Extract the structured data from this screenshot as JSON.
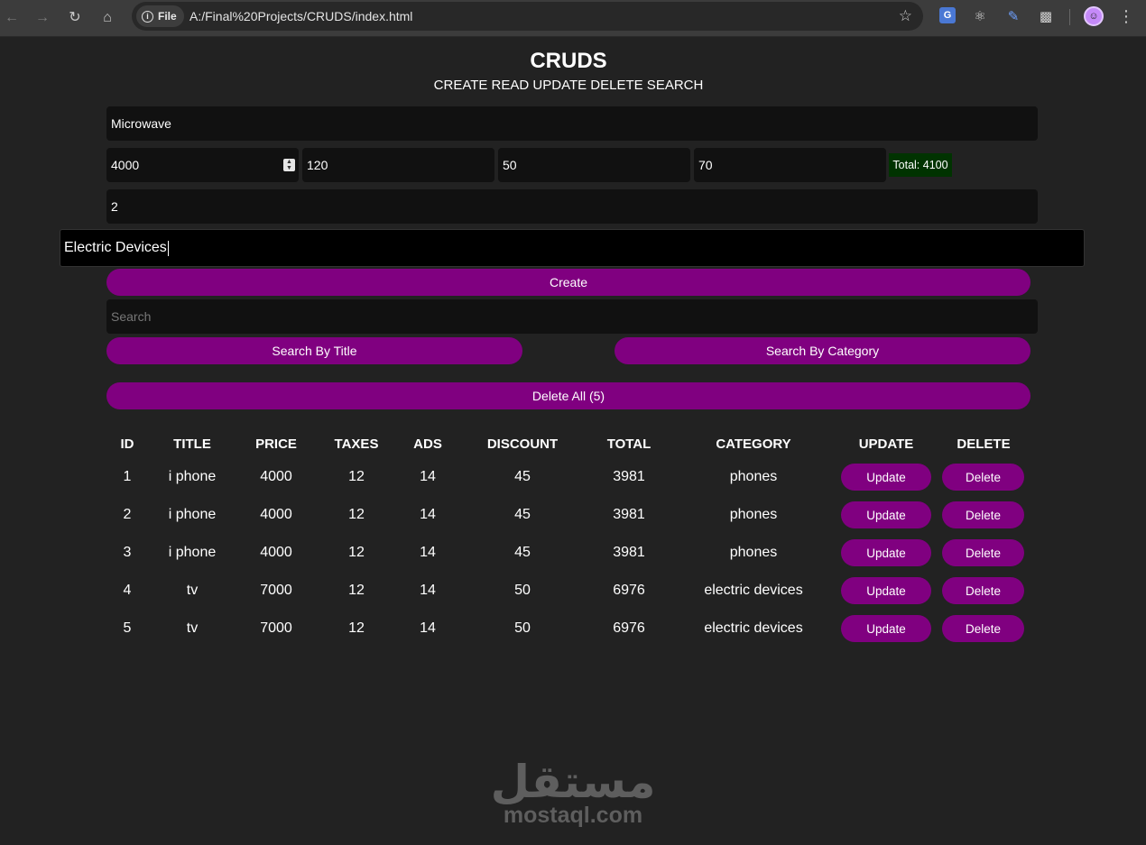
{
  "browser": {
    "site_chip": "File",
    "url": "A:/Final%20Projects/CRUDS/index.html"
  },
  "page": {
    "title": "CRUDS",
    "subtitle": "CREATE READ UPDATE DELETE SEARCH"
  },
  "form": {
    "title_value": "Microwave",
    "price_value": "4000",
    "taxes_value": "120",
    "ads_value": "50",
    "discount_value": "70",
    "total_label": "Total: 4100",
    "count_value": "2",
    "category_value": "Electric Devices",
    "create_label": "Create",
    "search_placeholder": "Search",
    "search_title_label": "Search By Title",
    "search_category_label": "Search By Category",
    "delete_all_label": "Delete All (5)"
  },
  "table": {
    "headers": [
      "ID",
      "TITLE",
      "PRICE",
      "TAXES",
      "ADS",
      "DISCOUNT",
      "TOTAL",
      "CATEGORY",
      "UPDATE",
      "DELETE"
    ],
    "update_label": "Update",
    "delete_label": "Delete",
    "rows": [
      {
        "id": "1",
        "title": "i phone",
        "price": "4000",
        "taxes": "12",
        "ads": "14",
        "discount": "45",
        "total": "3981",
        "category": "phones"
      },
      {
        "id": "2",
        "title": "i phone",
        "price": "4000",
        "taxes": "12",
        "ads": "14",
        "discount": "45",
        "total": "3981",
        "category": "phones"
      },
      {
        "id": "3",
        "title": "i phone",
        "price": "4000",
        "taxes": "12",
        "ads": "14",
        "discount": "45",
        "total": "3981",
        "category": "phones"
      },
      {
        "id": "4",
        "title": "tv",
        "price": "7000",
        "taxes": "12",
        "ads": "14",
        "discount": "50",
        "total": "6976",
        "category": "electric devices"
      },
      {
        "id": "5",
        "title": "tv",
        "price": "7000",
        "taxes": "12",
        "ads": "14",
        "discount": "50",
        "total": "6976",
        "category": "electric devices"
      }
    ]
  },
  "watermark": {
    "arabic": "مستقل",
    "latin": "mostaql.com"
  },
  "colors": {
    "background": "#222222",
    "button": "#800080",
    "field": "#111111",
    "total_badge": "#003300"
  }
}
